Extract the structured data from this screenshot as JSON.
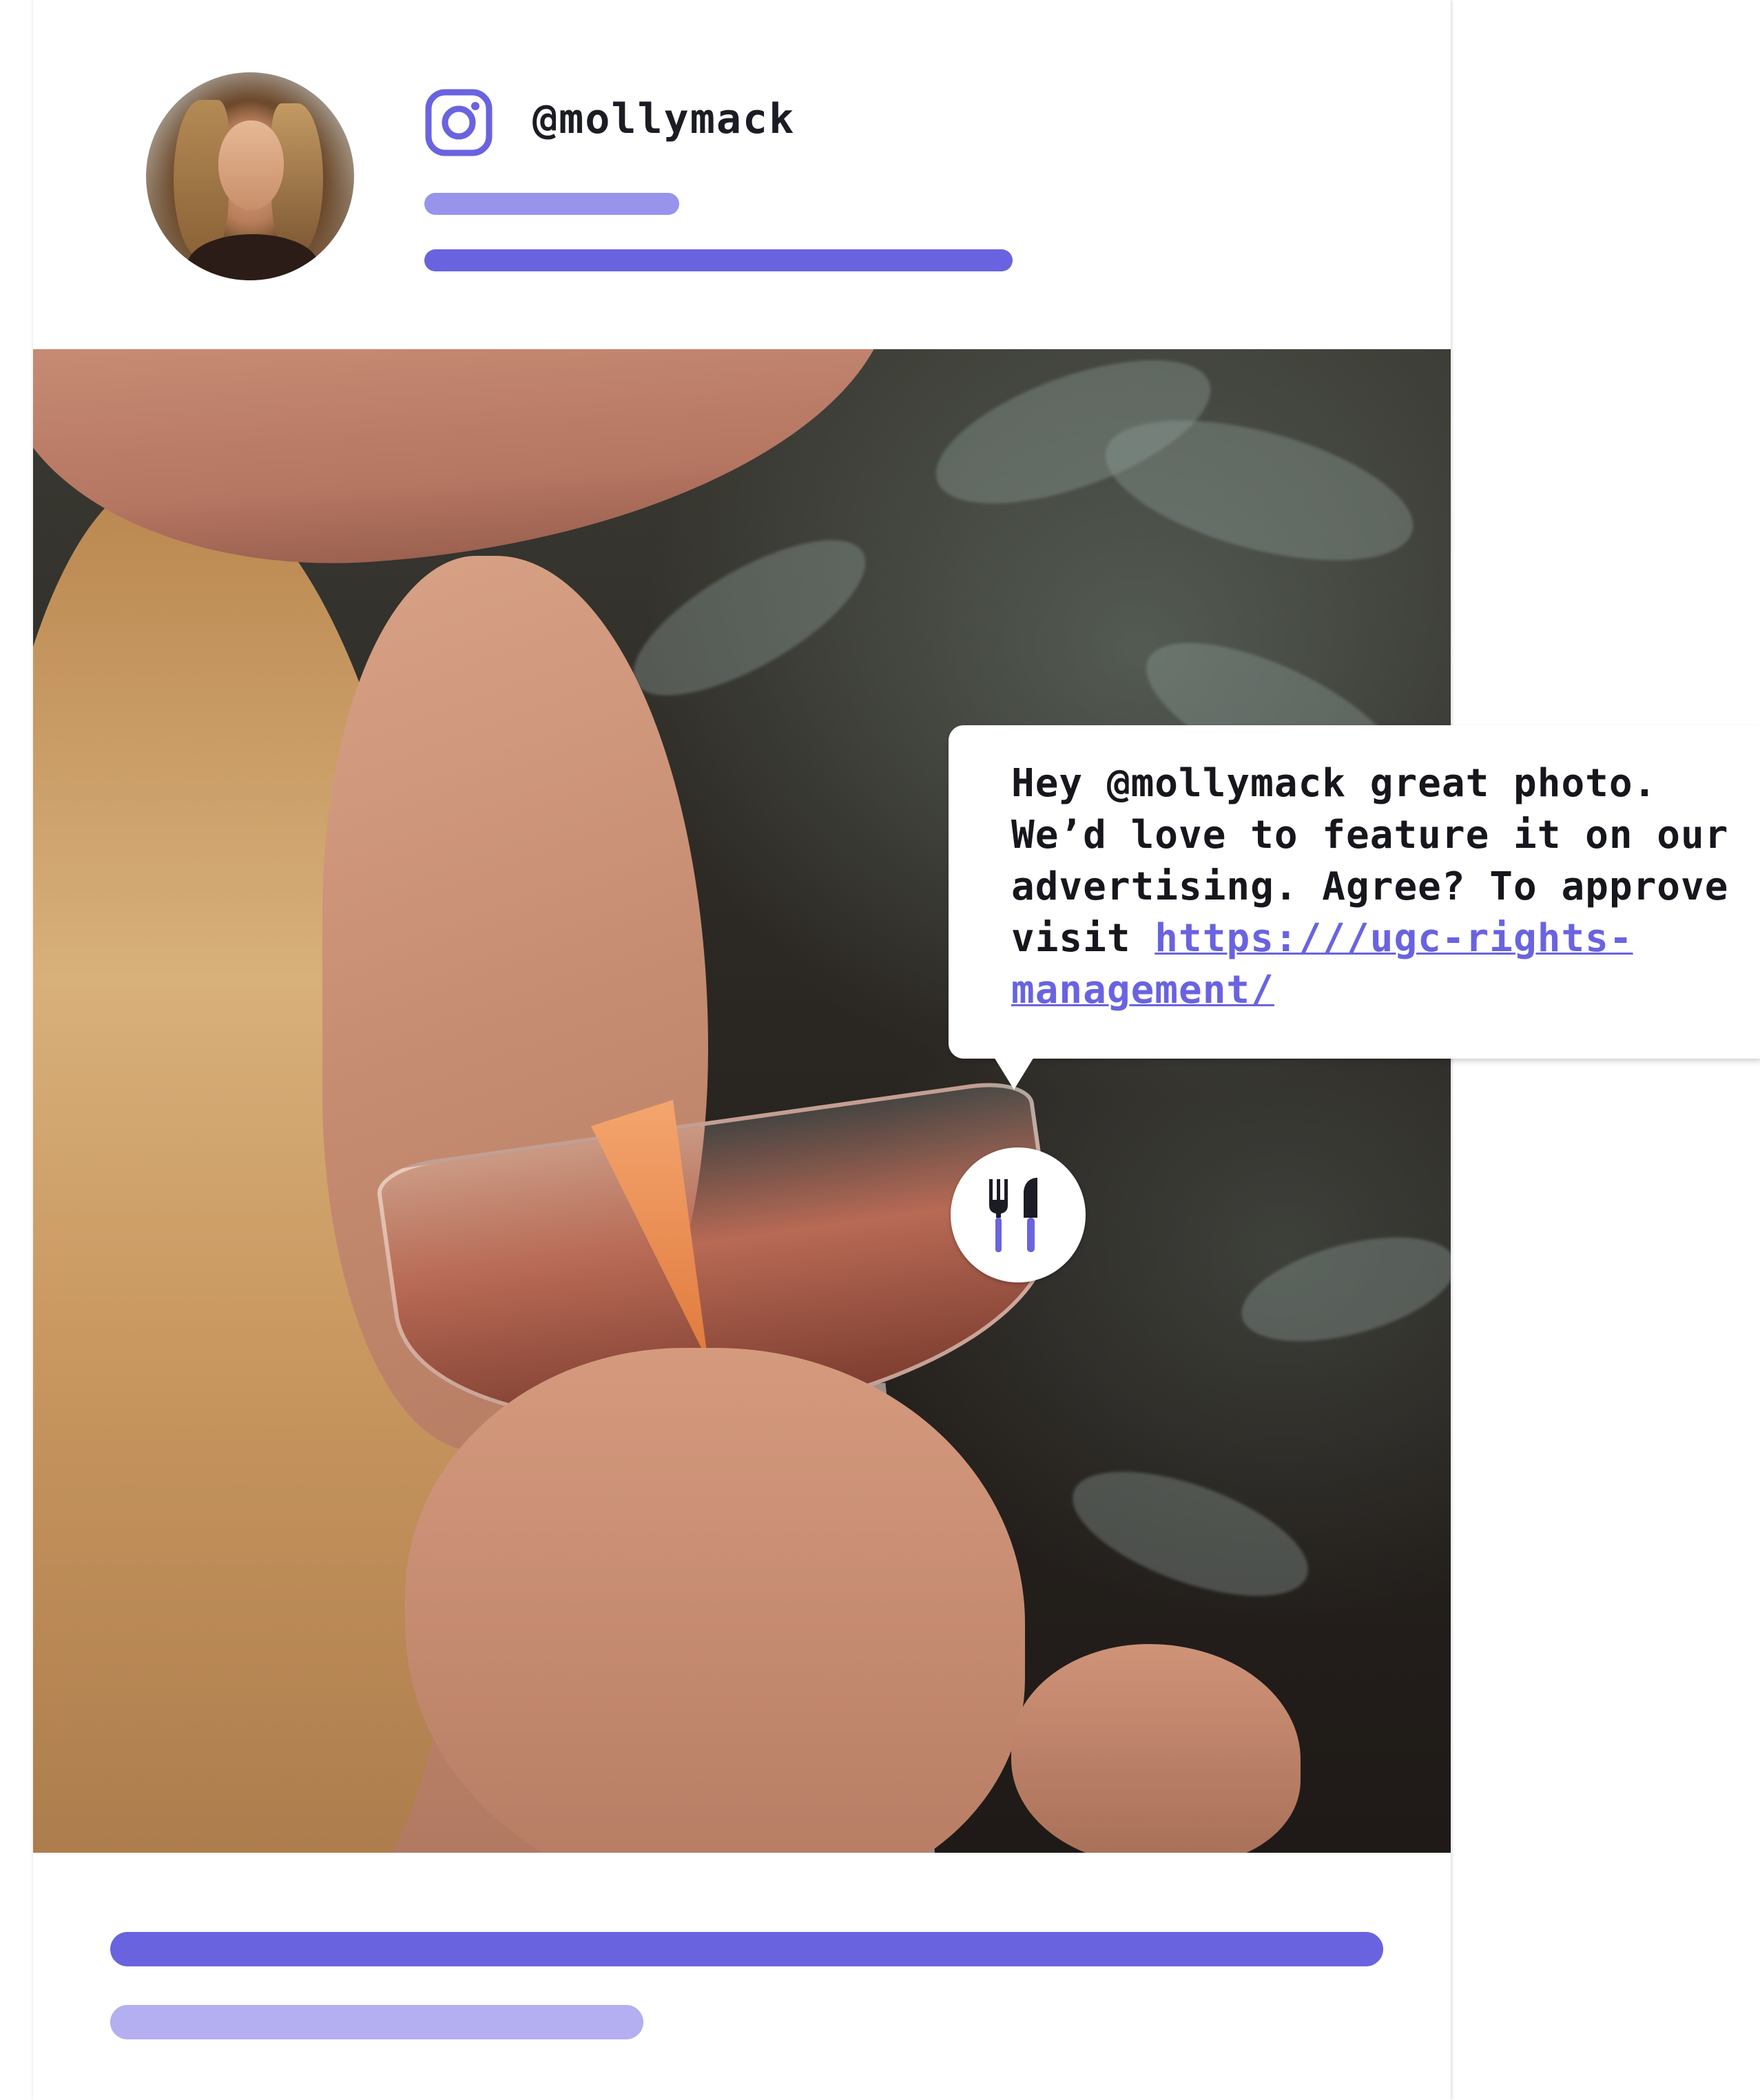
{
  "post": {
    "username": "@mollymack",
    "platform_icon": "instagram-icon",
    "category_icon": "fork-knife-icon"
  },
  "comment": {
    "text": "Hey @mollymack great photo. We’d love to feature it on our advertising. Agree? To approve visit",
    "link": "https:///ugc-rights-management/"
  },
  "colors": {
    "accent": "#6a63e0",
    "accent_light": "#9893eb",
    "accent_lighter": "#b3aff0",
    "text": "#1c1c24"
  }
}
